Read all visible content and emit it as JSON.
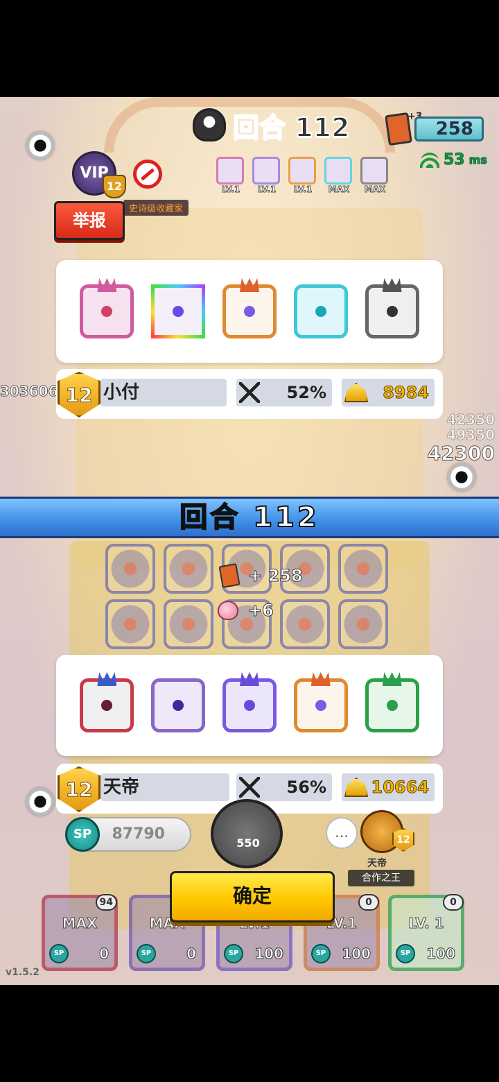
{
  "hud": {
    "round_label": "回合 112",
    "card_plus": "+3",
    "card_count": "258",
    "ping_value": "53",
    "ping_unit": "ms"
  },
  "player_top": {
    "vip_label": "VIP",
    "vip_level": "12",
    "collector_title": "史诗级收藏家",
    "report_label": "举报",
    "mini_skills": [
      {
        "label": "LV.1"
      },
      {
        "label": "LV.1"
      },
      {
        "label": "LV.1"
      },
      {
        "label": "MAX"
      },
      {
        "label": "MAX"
      }
    ],
    "rank": "12",
    "name": "小付",
    "win_rate": "52%",
    "gold": "8984"
  },
  "side_scores": {
    "left": "303606",
    "right_a": "42350",
    "right_b": "49350",
    "right_c": "42300"
  },
  "round_banner": "回合  112",
  "gains": {
    "cards": "+ 258",
    "peach": "+6"
  },
  "player_bottom": {
    "rank": "12",
    "name": "天帝",
    "win_rate": "56%",
    "gold": "10664"
  },
  "controls": {
    "sp_label": "SP",
    "sp_value": "87790",
    "summon_cost": "550",
    "chat_label": "…",
    "coop_level": "12",
    "coop_name": "天帝",
    "coop_title": "合作之王",
    "confirm_label": "确定"
  },
  "deck": [
    {
      "lv": "MAX",
      "cost": "0",
      "count": "94"
    },
    {
      "lv": "MAX",
      "cost": "0",
      "count": ""
    },
    {
      "lv": "LV.1",
      "cost": "100",
      "count": ""
    },
    {
      "lv": "LV.1",
      "cost": "100",
      "count": "0"
    },
    {
      "lv": "LV. 1",
      "cost": "100",
      "count": "0"
    }
  ],
  "version": "v1.5.2",
  "colors": {
    "banner_blue": "#3f8fe8",
    "confirm_yellow": "#ffc800",
    "report_red": "#d82a18",
    "gold_text": "#f0b400"
  }
}
